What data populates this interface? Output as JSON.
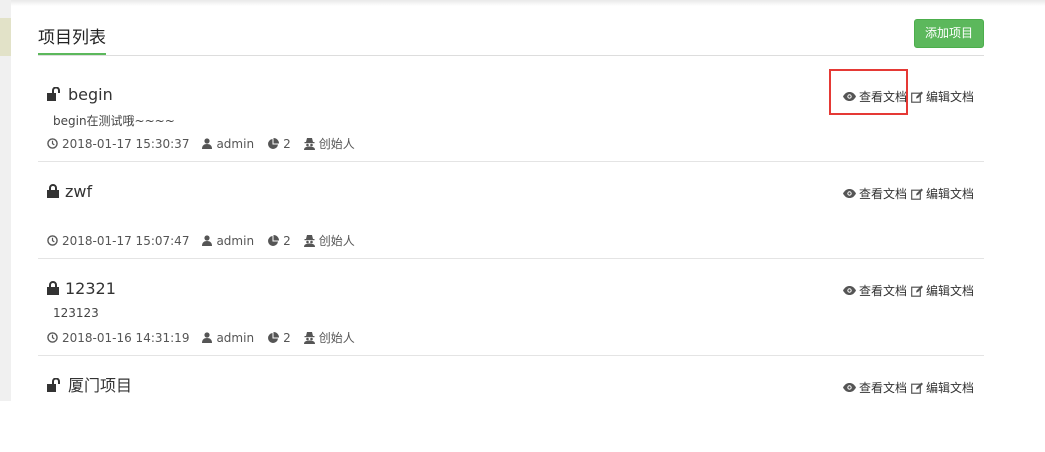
{
  "header": {
    "title": "项目列表",
    "add_button": "添加项目"
  },
  "projects": [
    {
      "name": "begin",
      "lock": "unlocked",
      "description": "begin在测试哦~~~~",
      "datetime": "2018-01-17 15:30:37",
      "author": "admin",
      "doc_count": "2",
      "role": "创始人",
      "view_label": "查看文档",
      "edit_label": "编辑文档"
    },
    {
      "name": "zwf",
      "lock": "locked",
      "description": "",
      "datetime": "2018-01-17 15:07:47",
      "author": "admin",
      "doc_count": "2",
      "role": "创始人",
      "view_label": "查看文档",
      "edit_label": "编辑文档"
    },
    {
      "name": "12321",
      "lock": "locked",
      "description": "123123",
      "datetime": "2018-01-16 14:31:19",
      "author": "admin",
      "doc_count": "2",
      "role": "创始人",
      "view_label": "查看文档",
      "edit_label": "编辑文档"
    },
    {
      "name": "厦门项目",
      "lock": "unlocked",
      "description": "",
      "datetime": "",
      "author": "",
      "doc_count": "",
      "role": "",
      "view_label": "查看文档",
      "edit_label": "编辑文档"
    }
  ],
  "colors": {
    "accent": "#5cb85c",
    "highlight": "#e53935"
  },
  "icons": [
    "unlock-icon",
    "lock-icon",
    "clock-icon",
    "user-icon",
    "pie-chart-icon",
    "user-secret-icon",
    "eye-icon",
    "edit-icon"
  ]
}
